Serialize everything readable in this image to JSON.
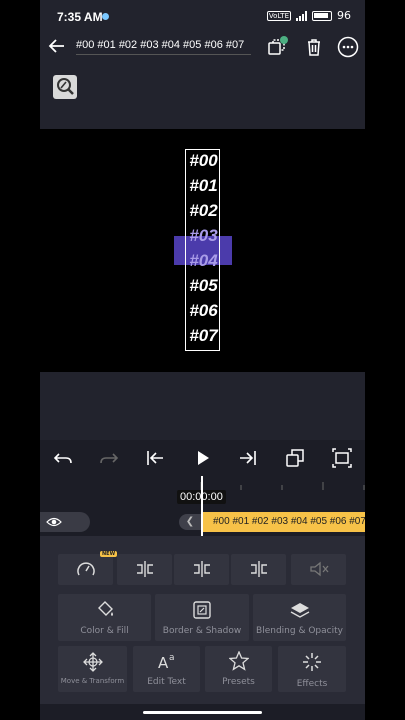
{
  "status_bar": {
    "time": "7:35 AM",
    "network": "VoLTE",
    "battery": "96"
  },
  "header": {
    "title": "#00 #01 #02 #03 #04 #05 #06 #07"
  },
  "canvas": {
    "labels": [
      "#00",
      "#01",
      "#02",
      "#03",
      "#04",
      "#05",
      "#06",
      "#07"
    ]
  },
  "timeline": {
    "timecode": "00:00:00",
    "clip_label": "#00 #01 #02 #03 #04 #05 #06 #07"
  },
  "tools": {
    "new_badge": "NEW",
    "color_fill": "Color & Fill",
    "border_shadow": "Border & Shadow",
    "blending_opacity": "Blending & Opacity",
    "move_transform": "Move & Transform",
    "edit_text": "Edit Text",
    "presets": "Presets",
    "effects": "Effects"
  },
  "colors": {
    "accent_clip": "#f7c248",
    "highlight": "#4b3bab",
    "badge": "#4caf82"
  }
}
